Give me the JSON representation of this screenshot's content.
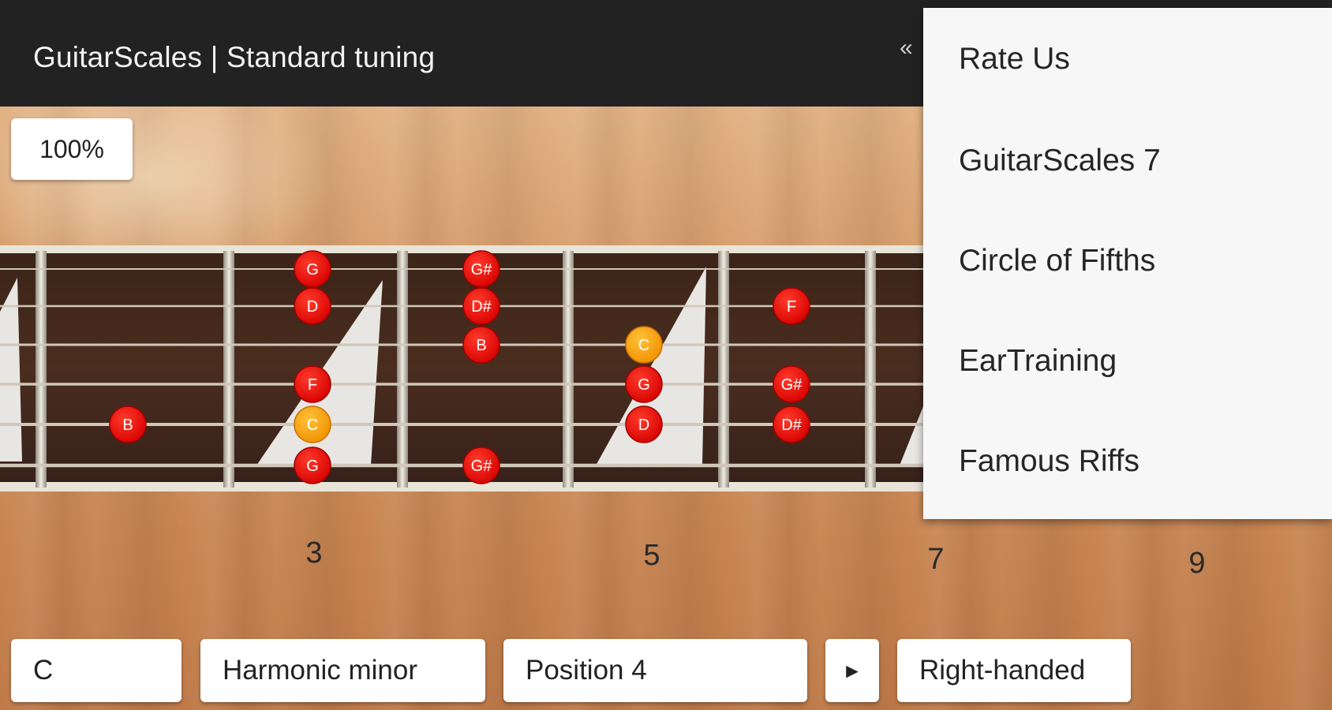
{
  "appbar": {
    "title": "GuitarScales | Standard tuning",
    "overflow_glyph": "«"
  },
  "zoom": {
    "label": "100%"
  },
  "fretboard": {
    "root_color": "#f5a100",
    "note_color": "#e00000",
    "notes": [
      {
        "label": "B",
        "string": 5,
        "fret": 2
      },
      {
        "label": "G",
        "string": 1,
        "fret": 3
      },
      {
        "label": "D",
        "string": 2,
        "fret": 3
      },
      {
        "label": "F",
        "string": 4,
        "fret": 3
      },
      {
        "label": "C",
        "string": 5,
        "fret": 3,
        "root": true
      },
      {
        "label": "G",
        "string": 6,
        "fret": 3
      },
      {
        "label": "G#",
        "string": 1,
        "fret": 4
      },
      {
        "label": "D#",
        "string": 2,
        "fret": 4
      },
      {
        "label": "B",
        "string": 3,
        "fret": 4
      },
      {
        "label": "G#",
        "string": 6,
        "fret": 4
      },
      {
        "label": "C",
        "string": 3,
        "fret": 5,
        "root": true
      },
      {
        "label": "G",
        "string": 4,
        "fret": 5
      },
      {
        "label": "D",
        "string": 5,
        "fret": 5
      },
      {
        "label": "F",
        "string": 2,
        "fret": 6
      },
      {
        "label": "G#",
        "string": 4,
        "fret": 6
      },
      {
        "label": "D#",
        "string": 5,
        "fret": 6
      }
    ],
    "fret_numbers": [
      "3",
      "5",
      "7",
      "9"
    ]
  },
  "controls": {
    "key": "C",
    "scale": "Harmonic minor",
    "position": "Position 4",
    "play_glyph": "►",
    "handedness": "Right-handed"
  },
  "menu": {
    "items": [
      {
        "label": "Rate Us"
      },
      {
        "label": "GuitarScales 7"
      },
      {
        "label": "Circle of Fifths"
      },
      {
        "label": "EarTraining"
      },
      {
        "label": "Famous Riffs"
      }
    ]
  }
}
